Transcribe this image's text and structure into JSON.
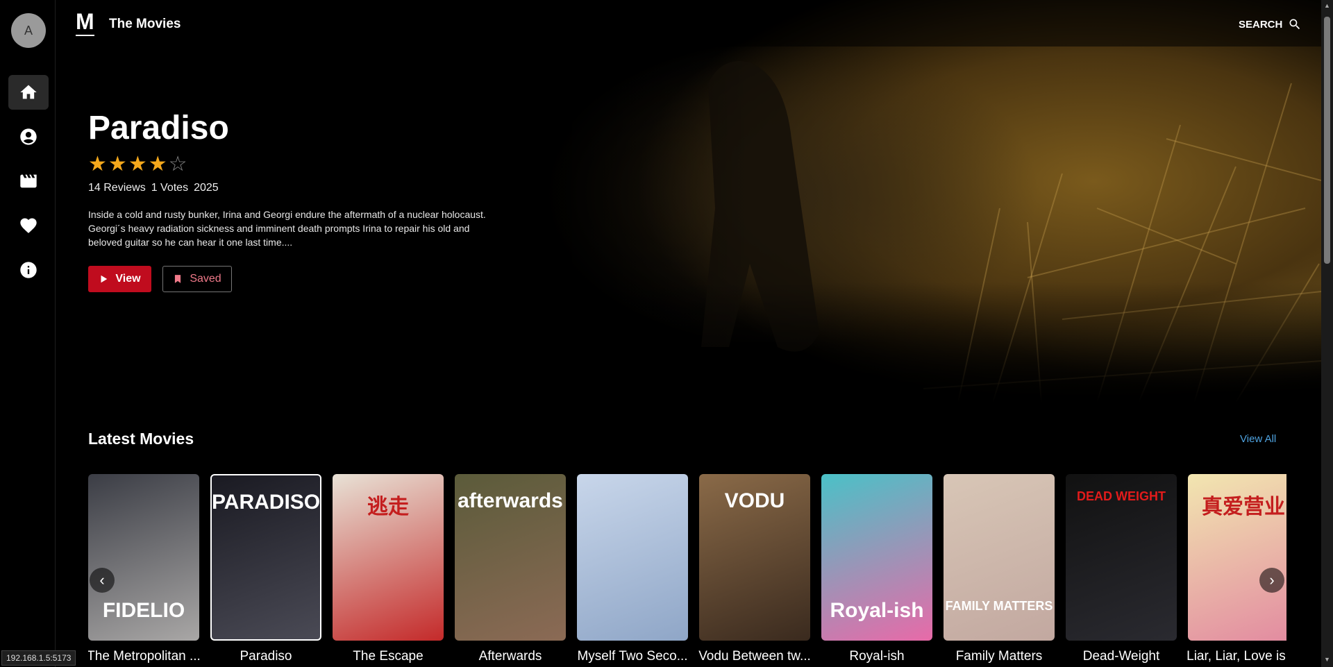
{
  "app": {
    "logo": "M",
    "brand": "The Movies",
    "search_label": "SEARCH"
  },
  "sidebar": {
    "avatar_initial": "A",
    "items": [
      {
        "icon": "home-icon",
        "active": true
      },
      {
        "icon": "user-circle-icon",
        "active": false
      },
      {
        "icon": "clapperboard-icon",
        "active": false
      },
      {
        "icon": "heart-icon",
        "active": false
      },
      {
        "icon": "info-icon",
        "active": false
      }
    ]
  },
  "hero": {
    "title": "Paradiso",
    "rating": 4,
    "rating_max": 5,
    "reviews": "14 Reviews",
    "votes": "1 Votes",
    "year": "2025",
    "description": "Inside a cold and rusty bunker, Irina and Georgi endure the aftermath of a nuclear holocaust. Georgi´s heavy radiation sickness and imminent death prompts Irina to repair his old and beloved guitar so he can hear it one last time....",
    "view_label": "View",
    "saved_label": "Saved"
  },
  "latest": {
    "title": "Latest Movies",
    "view_all": "View All",
    "movies": [
      {
        "title": "The Metropolitan ...",
        "poster_text": "FIDELIO",
        "colors": [
          "#3b3d45",
          "#a9a7a6"
        ]
      },
      {
        "title": "Paradiso",
        "poster_text": "PARADISO",
        "colors": [
          "#1a1a22",
          "#4a4a55"
        ],
        "selected": true
      },
      {
        "title": "The Escape",
        "poster_text": "逃走",
        "colors": [
          "#e8e2d6",
          "#c42a2a"
        ]
      },
      {
        "title": "Afterwards",
        "poster_text": "afterwards",
        "colors": [
          "#5b5b3a",
          "#8b6a55"
        ]
      },
      {
        "title": "Myself Two Seco...",
        "poster_text": "",
        "colors": [
          "#c8d6ea",
          "#8fa6c7"
        ]
      },
      {
        "title": "Vodu Between tw...",
        "poster_text": "VODU",
        "colors": [
          "#8a6a48",
          "#3a2a1e"
        ]
      },
      {
        "title": "Royal-ish",
        "poster_text": "Royal-ish",
        "colors": [
          "#4ac1c7",
          "#e86aa8"
        ]
      },
      {
        "title": "Family Matters",
        "poster_text": "FAMILY MATTERS",
        "colors": [
          "#d8c6b6",
          "#c2a8a0"
        ]
      },
      {
        "title": "Dead-Weight",
        "poster_text": "DEAD WEIGHT",
        "colors": [
          "#111",
          "#2a2a30"
        ]
      },
      {
        "title": "Liar, Liar, Love is ...",
        "poster_text": "真爱营业",
        "colors": [
          "#f2e6b0",
          "#e28aa0"
        ]
      }
    ]
  },
  "status_url": "192.168.1.5:5173"
}
